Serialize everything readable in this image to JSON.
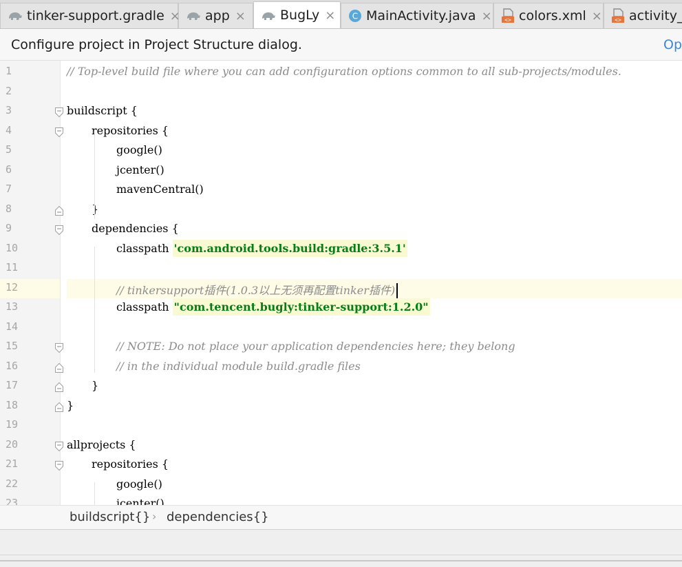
{
  "tabs": [
    {
      "label": "tinker-support.gradle",
      "icon": "gradle-icon",
      "active": false
    },
    {
      "label": "app",
      "icon": "gradle-icon",
      "active": false
    },
    {
      "label": "BugLy",
      "icon": "gradle-icon",
      "active": true
    },
    {
      "label": "MainActivity.java",
      "icon": "java-class-icon",
      "active": false
    },
    {
      "label": "colors.xml",
      "icon": "xml-file-icon",
      "active": false
    },
    {
      "label": "activity_m",
      "icon": "xml-file-icon",
      "active": false
    }
  ],
  "tab_close_glyph": "×",
  "banner": {
    "message": "Configure project in Project Structure dialog.",
    "link": "Op"
  },
  "editor": {
    "lines": [
      {
        "n": "1",
        "text": "// Top-level build file where you can add configuration options common to all sub-projects/modules."
      },
      {
        "n": "2",
        "text": ""
      },
      {
        "n": "3",
        "text": "buildscript {"
      },
      {
        "n": "4",
        "text": "repositories {"
      },
      {
        "n": "5",
        "text": "google()"
      },
      {
        "n": "6",
        "text": "jcenter()"
      },
      {
        "n": "7",
        "text": "mavenCentral()"
      },
      {
        "n": "8",
        "text": "}"
      },
      {
        "n": "9",
        "text": "dependencies {"
      },
      {
        "n": "10",
        "text": "classpath ",
        "str": "'com.android.tools.build:gradle:3.5.1'"
      },
      {
        "n": "11",
        "text": ""
      },
      {
        "n": "12",
        "text": "// tinkersupport插件(1.0.3以上无须再配置tinker插件)"
      },
      {
        "n": "13",
        "text": "classpath ",
        "str": "\"com.tencent.bugly:tinker-support:1.2.0\""
      },
      {
        "n": "14",
        "text": ""
      },
      {
        "n": "15",
        "text": "// NOTE: Do not place your application dependencies here; they belong"
      },
      {
        "n": "16",
        "text": "// in the individual module build.gradle files"
      },
      {
        "n": "17",
        "text": "}"
      },
      {
        "n": "18",
        "text": "}"
      },
      {
        "n": "19",
        "text": ""
      },
      {
        "n": "20",
        "text": "allprojects {"
      },
      {
        "n": "21",
        "text": "repositories {"
      },
      {
        "n": "22",
        "text": "google()"
      },
      {
        "n": "23",
        "text": "jcenter()"
      }
    ]
  },
  "breadcrumb": {
    "items": [
      "buildscript{}",
      "dependencies{}"
    ],
    "separator": "›"
  },
  "colors": {
    "comment": "#8c8c8c",
    "string": "#067d17",
    "string_bg": "#fafad2",
    "caret_line": "#fefce6",
    "link": "#3d86d8"
  }
}
